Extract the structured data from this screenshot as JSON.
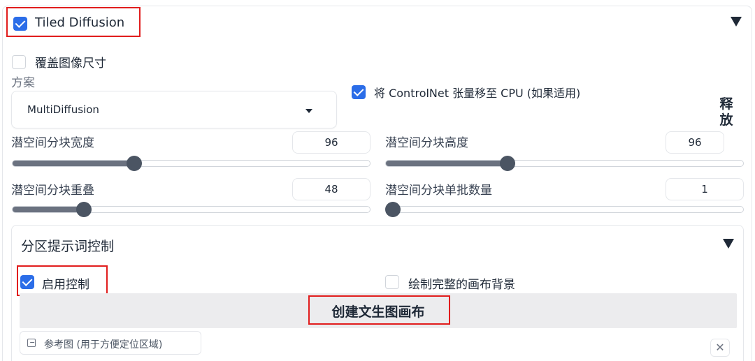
{
  "header": {
    "title": "Tiled Diffusion",
    "enabled": true
  },
  "options": {
    "overwrite_size_label": "覆盖图像尺寸",
    "scheme_label": "方案",
    "scheme_value": "MultiDiffusion",
    "move_to_cpu_label": "将 ControlNet 张量移至 CPU (如果适用)",
    "release_button_label": "释放"
  },
  "sliders": [
    {
      "label": "潜空间分块宽度",
      "value": "96",
      "fraction": 0.34
    },
    {
      "label": "潜空间分块高度",
      "value": "96",
      "fraction": 0.34
    },
    {
      "label": "潜空间分块重叠",
      "value": "48",
      "fraction": 0.2
    },
    {
      "label": "潜空间分块单批数量",
      "value": "1",
      "fraction": 0.0
    }
  ],
  "region": {
    "title": "分区提示词控制",
    "enable_label": "启用控制",
    "draw_bg_label": "绘制完整的画布背景",
    "create_button_label": "创建文生图画布",
    "reference_label": "参考图 (用于方便定位区域)",
    "close_symbol": "✕"
  },
  "icons": {
    "collapse": "triangle-down-icon",
    "dropdown": "chevron-down-icon",
    "image": "image-icon",
    "close": "close-icon"
  },
  "colors": {
    "accent": "#2b6de8",
    "highlight_box": "#e11d1d"
  }
}
